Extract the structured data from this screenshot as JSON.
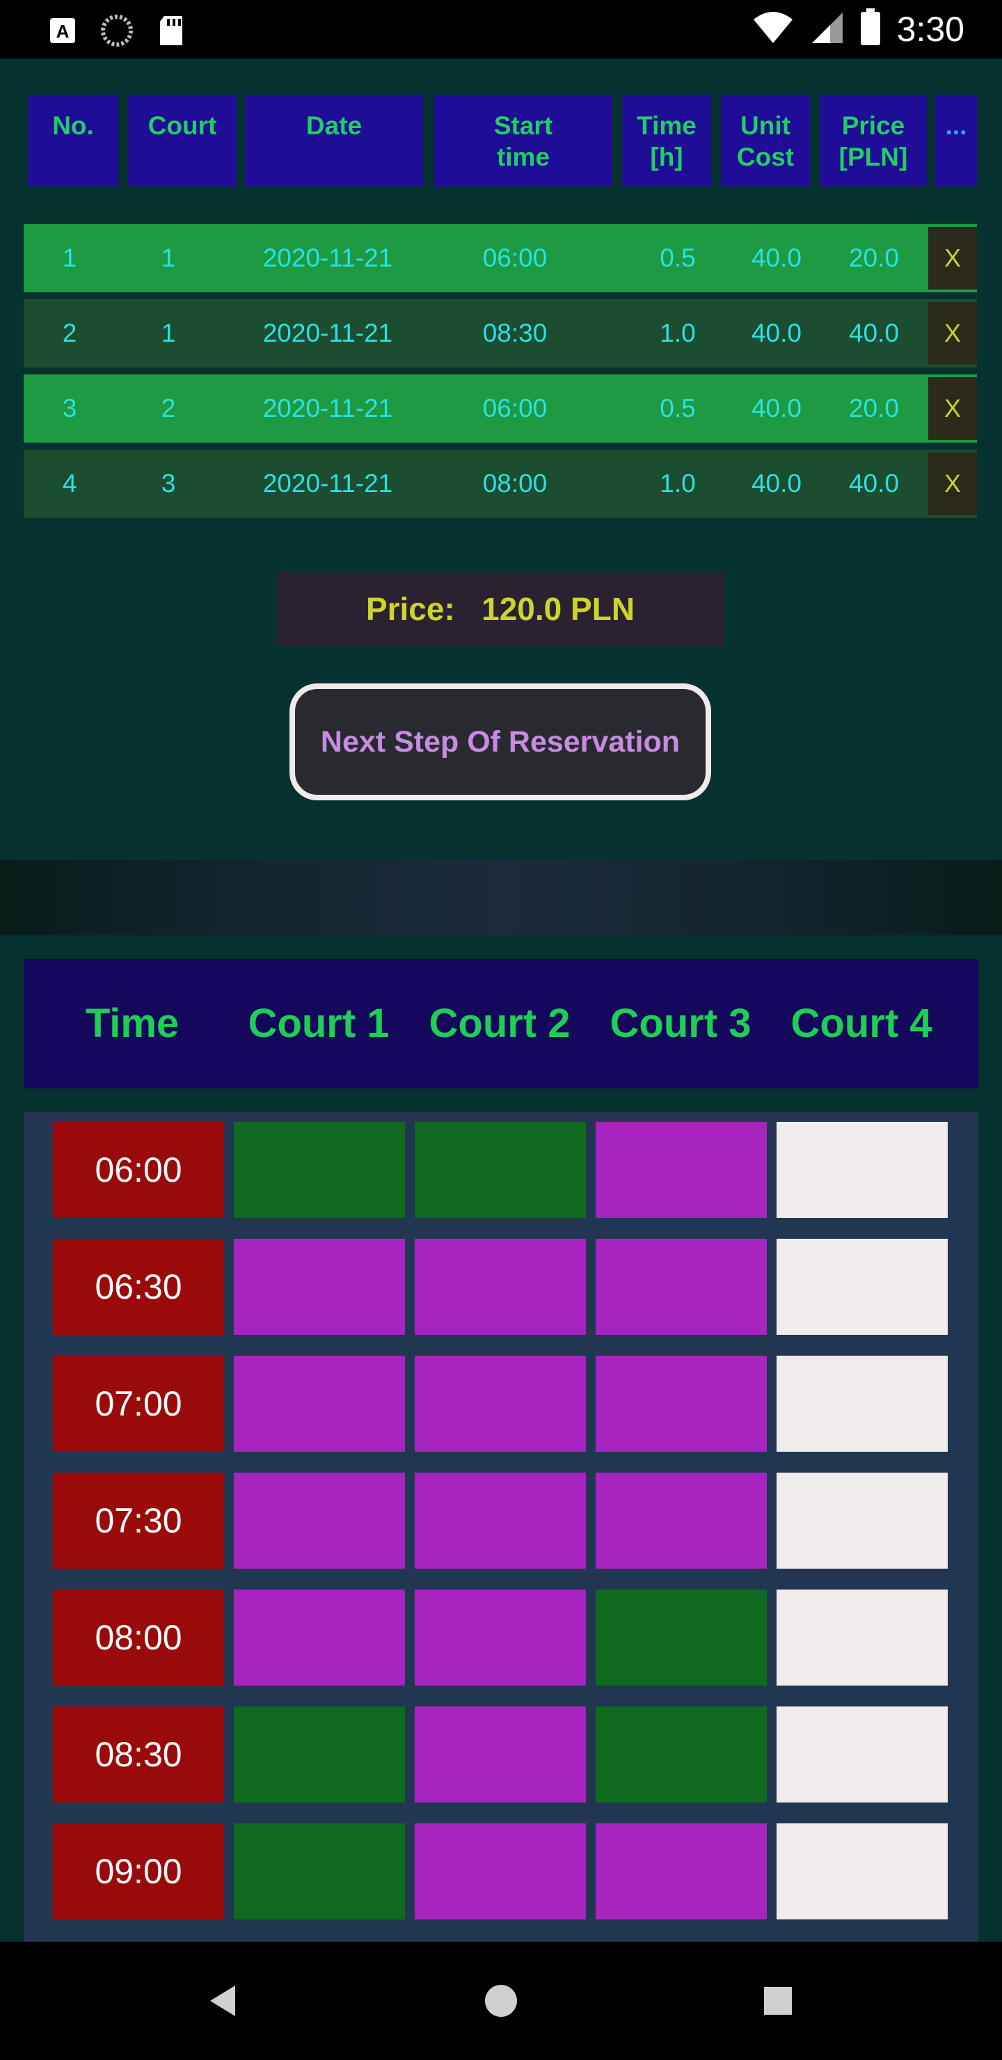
{
  "status_bar": {
    "time": "3:30",
    "icons": [
      "a-accessibility-icon",
      "sync-icon",
      "sd-card-icon",
      "wifi-icon",
      "signal-icon",
      "battery-icon"
    ]
  },
  "table": {
    "headers": [
      "No.",
      "Court",
      "Date",
      "Start\ntime",
      "Time\n[h]",
      "Unit\nCost",
      "Price\n[PLN]",
      "..."
    ],
    "rows": [
      {
        "no": "1",
        "court": "1",
        "date": "2020-11-21",
        "start": "06:00",
        "hours": "0.5",
        "unit_cost": "40.0",
        "price": "20.0",
        "remove": "X"
      },
      {
        "no": "2",
        "court": "1",
        "date": "2020-11-21",
        "start": "08:30",
        "hours": "1.0",
        "unit_cost": "40.0",
        "price": "40.0",
        "remove": "X"
      },
      {
        "no": "3",
        "court": "2",
        "date": "2020-11-21",
        "start": "06:00",
        "hours": "0.5",
        "unit_cost": "40.0",
        "price": "20.0",
        "remove": "X"
      },
      {
        "no": "4",
        "court": "3",
        "date": "2020-11-21",
        "start": "08:00",
        "hours": "1.0",
        "unit_cost": "40.0",
        "price": "40.0",
        "remove": "X"
      }
    ]
  },
  "summary": {
    "price_label": "Price:",
    "price_value": "120.0 PLN"
  },
  "next_button": "Next Step Of Reservation",
  "schedule": {
    "headers": [
      "Time",
      "Court 1",
      "Court 2",
      "Court 3",
      "Court 4"
    ],
    "rows": [
      {
        "time": "06:00",
        "slots": [
          "selected",
          "selected",
          "free",
          "unavailable"
        ]
      },
      {
        "time": "06:30",
        "slots": [
          "free",
          "free",
          "free",
          "unavailable"
        ]
      },
      {
        "time": "07:00",
        "slots": [
          "free",
          "free",
          "free",
          "unavailable"
        ]
      },
      {
        "time": "07:30",
        "slots": [
          "free",
          "free",
          "free",
          "unavailable"
        ]
      },
      {
        "time": "08:00",
        "slots": [
          "free",
          "free",
          "selected",
          "unavailable"
        ]
      },
      {
        "time": "08:30",
        "slots": [
          "selected",
          "free",
          "selected",
          "unavailable"
        ]
      },
      {
        "time": "09:00",
        "slots": [
          "selected",
          "free",
          "free",
          "unavailable"
        ]
      }
    ],
    "slot_colors": {
      "free": "#a724c0",
      "selected": "#0f6a1e",
      "unavailable": "#f1ecec"
    },
    "time_cell_color": "#9b0a0a"
  },
  "nav_bar": {
    "buttons": [
      "back-icon",
      "home-icon",
      "recents-icon"
    ]
  }
}
